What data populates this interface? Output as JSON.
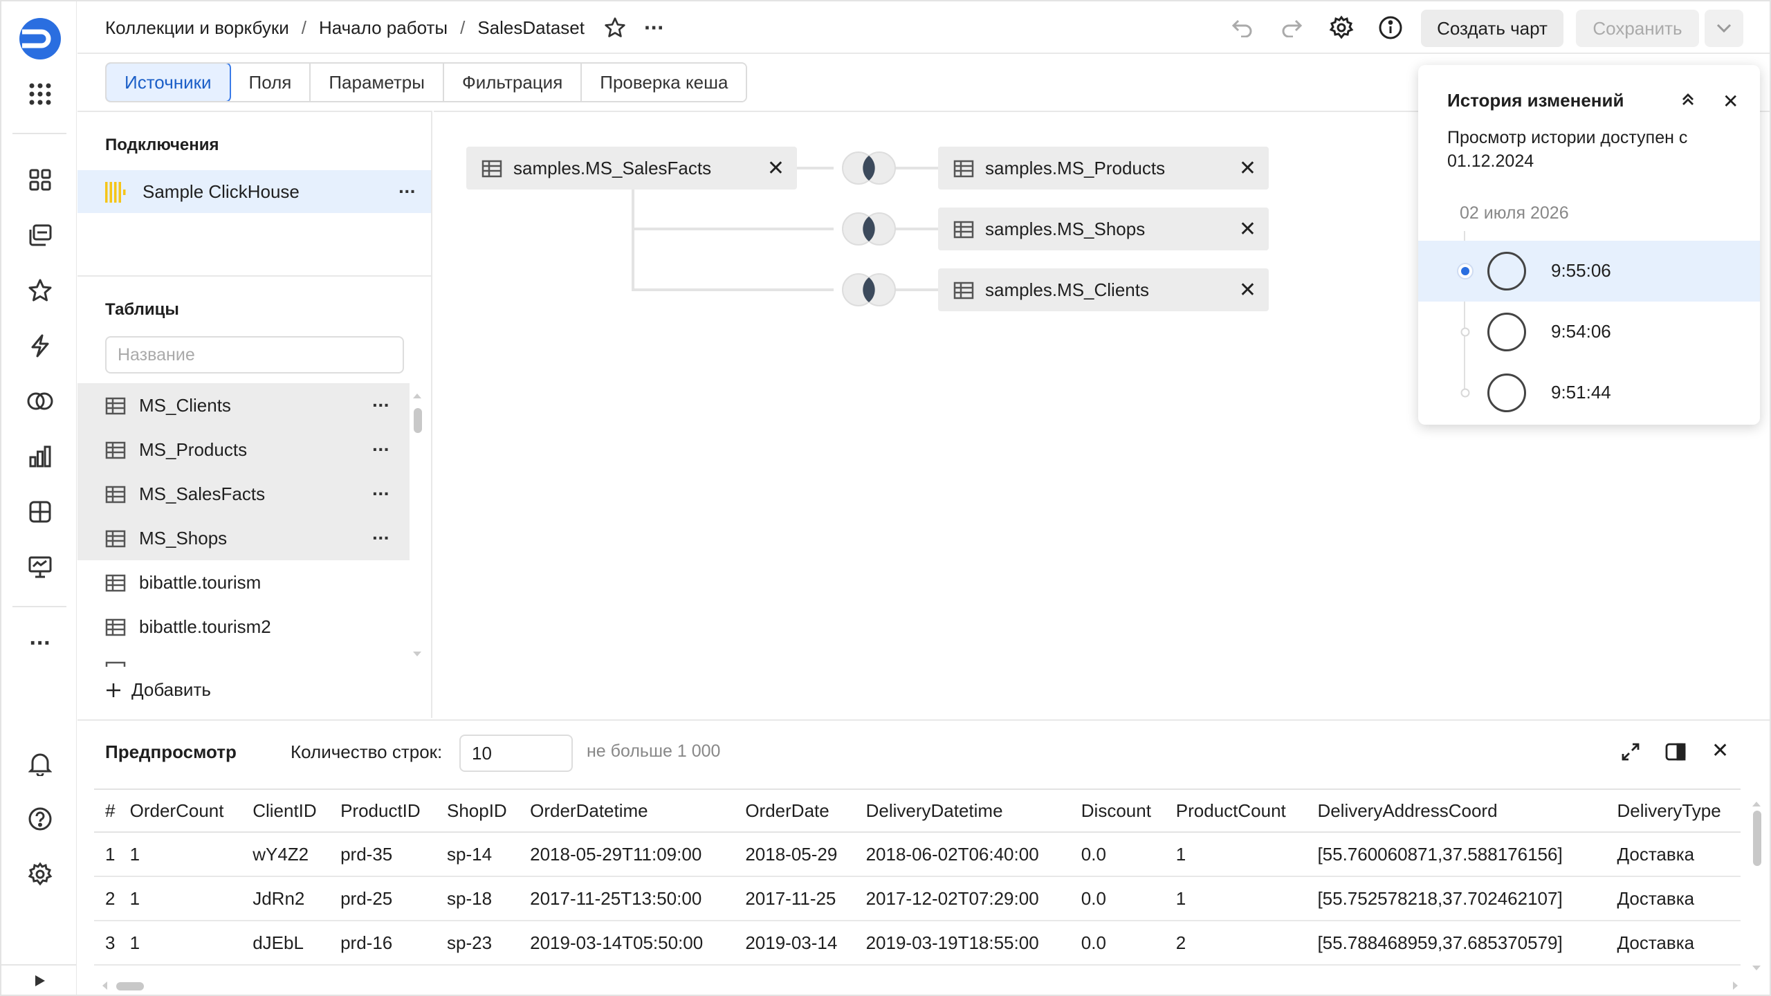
{
  "header": {
    "breadcrumbs": [
      "Коллекции и воркбуки",
      "Начало работы"
    ],
    "separator": "/",
    "current": "SalesDataset",
    "create_chart": "Создать чарт",
    "save": "Сохранить"
  },
  "tabs": [
    "Источники",
    "Поля",
    "Параметры",
    "Фильтрация",
    "Проверка кеша"
  ],
  "connections": {
    "title": "Подключения",
    "items": [
      {
        "label": "Sample ClickHouse"
      }
    ]
  },
  "tables": {
    "title": "Таблицы",
    "search_placeholder": "Название",
    "items": [
      "MS_Clients",
      "MS_Products",
      "MS_SalesFacts",
      "MS_Shops",
      "bibattle.tourism",
      "bibattle.tourism2"
    ],
    "add_label": "Добавить"
  },
  "canvas": {
    "root": "samples.MS_SalesFacts",
    "joined": [
      "samples.MS_Products",
      "samples.MS_Shops",
      "samples.MS_Clients"
    ]
  },
  "history": {
    "title": "История изменений",
    "description": "Просмотр истории доступен с 01.12.2024",
    "date": "02 июля 2026",
    "entries": [
      "9:55:06",
      "9:54:06",
      "9:51:44"
    ]
  },
  "preview": {
    "title": "Предпросмотр",
    "rows_label": "Количество строк:",
    "rows_value": "10",
    "hint": "не больше 1 000",
    "columns": [
      "#",
      "OrderCount",
      "ClientID",
      "ProductID",
      "ShopID",
      "OrderDatetime",
      "OrderDate",
      "DeliveryDatetime",
      "Discount",
      "ProductCount",
      "DeliveryAddressCoord",
      "DeliveryType"
    ],
    "rows": [
      [
        "1",
        "1",
        "wY4Z2",
        "prd-35",
        "sp-14",
        "2018-05-29T11:09:00",
        "2018-05-29",
        "2018-06-02T06:40:00",
        "0.0",
        "1",
        "[55.760060871,37.588176156]",
        "Доставка"
      ],
      [
        "2",
        "1",
        "JdRn2",
        "prd-25",
        "sp-18",
        "2017-11-25T13:50:00",
        "2017-11-25",
        "2017-12-02T07:29:00",
        "0.0",
        "1",
        "[55.752578218,37.702462107]",
        "Доставка"
      ],
      [
        "3",
        "1",
        "dJEbL",
        "prd-16",
        "sp-23",
        "2019-03-14T05:50:00",
        "2019-03-14",
        "2019-03-19T18:55:00",
        "0.0",
        "2",
        "[55.788468959,37.685370579]",
        "Доставка"
      ]
    ]
  },
  "colors": {
    "accent": "#2a6ee0",
    "selection": "#e6f0fd",
    "clickhouse_yellow": "#f5c518"
  }
}
